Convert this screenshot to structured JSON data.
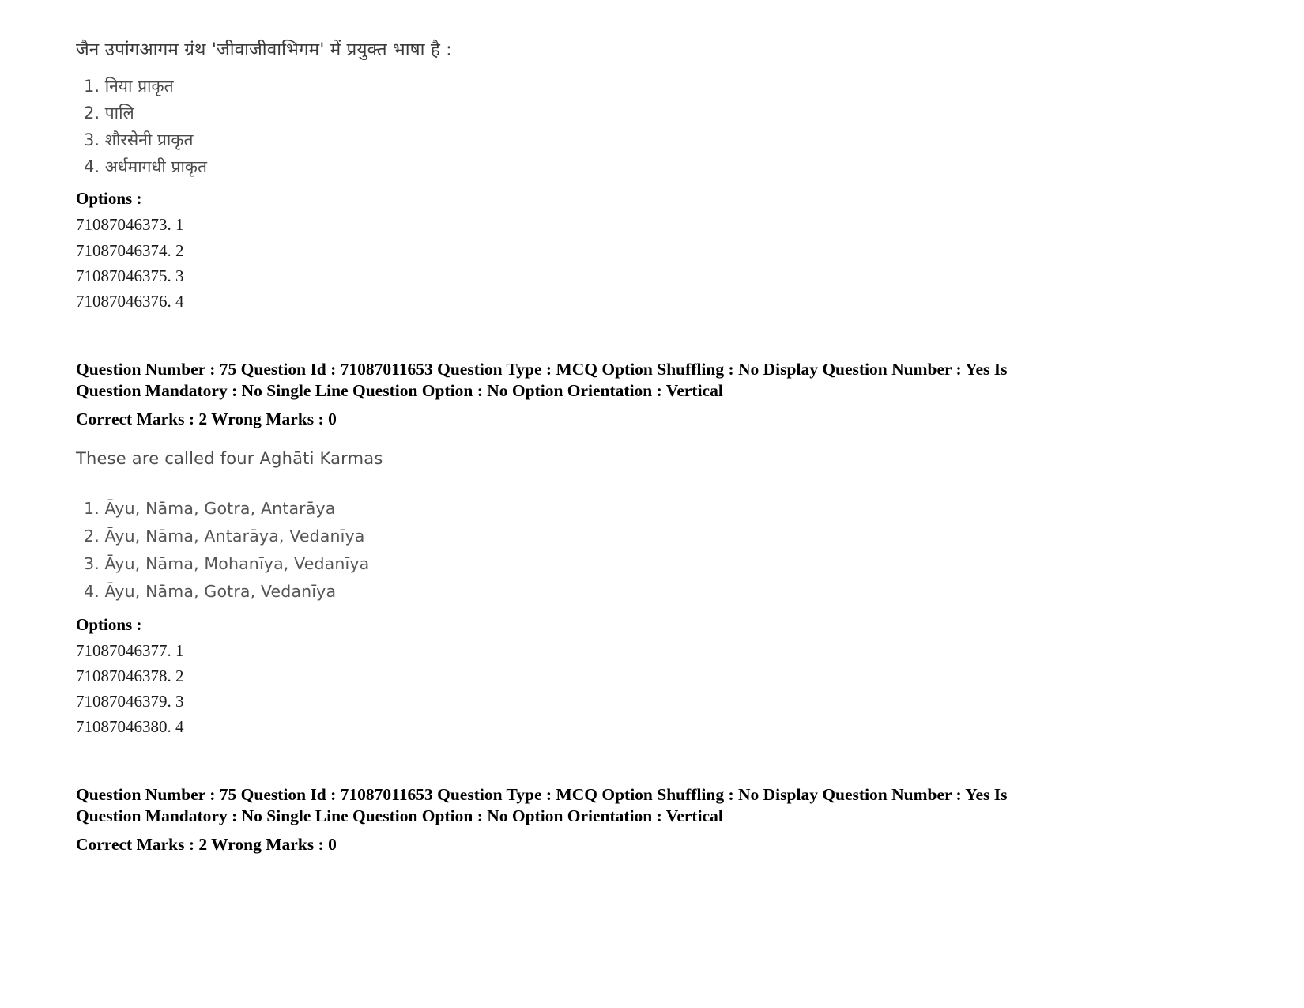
{
  "document": {
    "type": "exam-question-paper",
    "background_color": "#ffffff",
    "text_color": "#000000",
    "muted_text_color": "#4d4d4d"
  },
  "question_1": {
    "stem": "जैन उपांगआगम ग्रंथ 'जीवाजीवाभिगम' में प्रयुक्त भाषा है :",
    "choices": [
      "1. निया प्राकृत",
      "2. पालि",
      "3. शौरसेनी प्राकृत",
      "4. अर्धमागधी प्राकृत"
    ],
    "options_label": "Options :",
    "option_ids": [
      "71087046373. 1",
      "71087046374. 2",
      "71087046375. 3",
      "71087046376. 4"
    ]
  },
  "metadata_1": {
    "line1": "Question Number : 75 Question Id : 71087011653 Question Type : MCQ Option Shuffling : No Display Question Number : Yes Is",
    "line2": "Question Mandatory : No Single Line Question Option : No Option Orientation : Vertical",
    "marks": "Correct Marks : 2 Wrong Marks : 0",
    "question_number": "75",
    "question_id": "71087011653",
    "question_type": "MCQ",
    "option_shuffling": "No",
    "display_question_number": "Yes",
    "is_question_mandatory": "No",
    "single_line_question_option": "No",
    "option_orientation": "Vertical",
    "correct_marks": "2",
    "wrong_marks": "0"
  },
  "question_2": {
    "stem": "These are called four Aghāti Karmas",
    "choices": [
      "1. Āyu, Nāma, Gotra, Antarāya",
      "2. Āyu, Nāma, Antarāya, Vedanīya",
      "3. Āyu, Nāma, Mohanīya, Vedanīya",
      "4. Āyu, Nāma, Gotra, Vedanīya"
    ],
    "options_label": "Options :",
    "option_ids": [
      "71087046377. 1",
      "71087046378. 2",
      "71087046379. 3",
      "71087046380. 4"
    ]
  },
  "metadata_2": {
    "line1": "Question Number : 75 Question Id : 71087011653 Question Type : MCQ Option Shuffling : No Display Question Number : Yes Is",
    "line2": "Question Mandatory : No Single Line Question Option : No Option Orientation : Vertical",
    "marks": "Correct Marks : 2 Wrong Marks : 0",
    "question_number": "75",
    "question_id": "71087011653",
    "question_type": "MCQ",
    "option_shuffling": "No",
    "display_question_number": "Yes",
    "is_question_mandatory": "No",
    "single_line_question_option": "No",
    "option_orientation": "Vertical",
    "correct_marks": "2",
    "wrong_marks": "0"
  }
}
